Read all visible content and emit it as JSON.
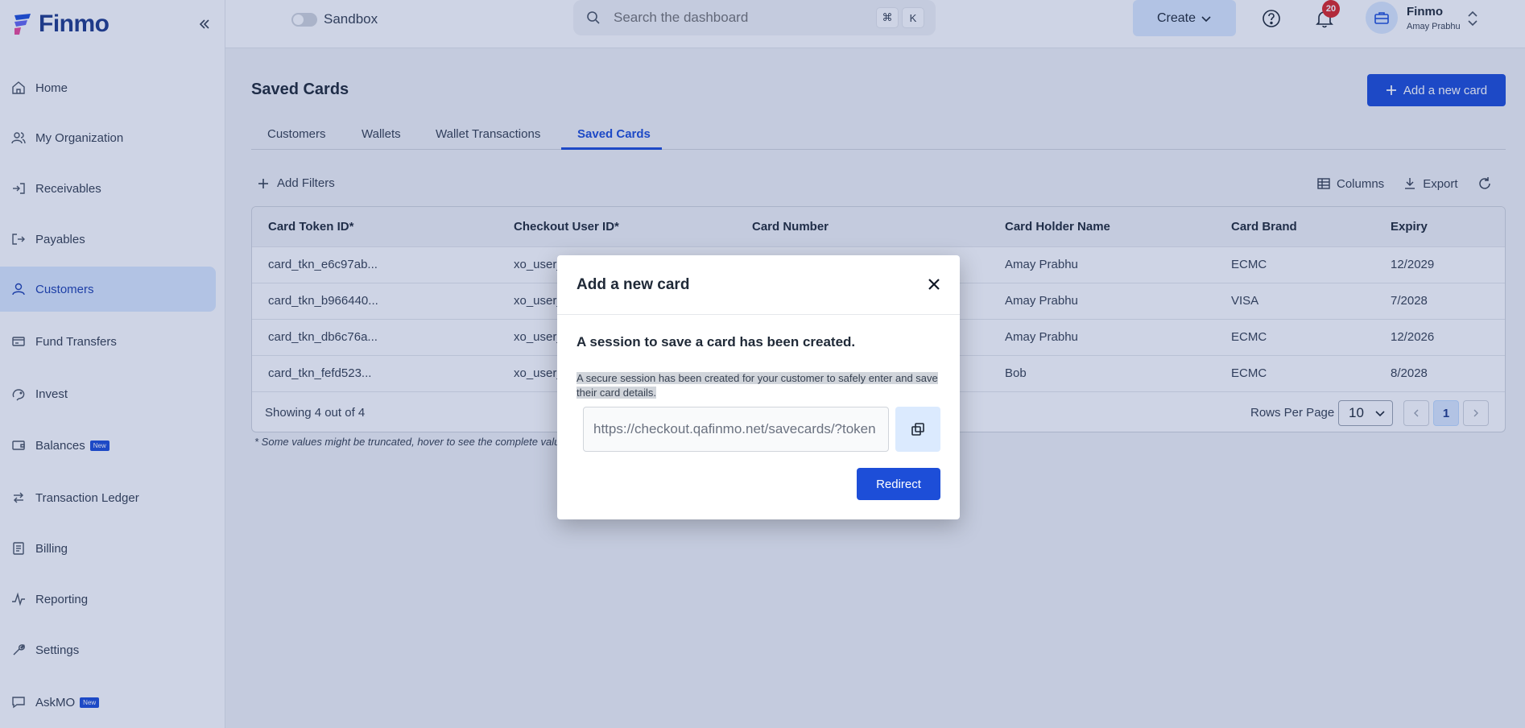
{
  "app": {
    "name": "Finmo"
  },
  "sidebar": {
    "items": [
      {
        "label": "Home",
        "icon": "home-icon"
      },
      {
        "label": "My Organization",
        "icon": "users-icon"
      },
      {
        "label": "Receivables",
        "icon": "receivables-icon"
      },
      {
        "label": "Payables",
        "icon": "payables-icon"
      },
      {
        "label": "Customers",
        "icon": "user-icon",
        "active": true
      },
      {
        "label": "Fund Transfers",
        "icon": "transfer-icon"
      },
      {
        "label": "Invest",
        "icon": "invest-icon"
      },
      {
        "label": "Balances",
        "icon": "wallet-icon",
        "badge": "New"
      },
      {
        "label": "Transaction Ledger",
        "icon": "ledger-icon"
      },
      {
        "label": "Billing",
        "icon": "billing-icon"
      },
      {
        "label": "Reporting",
        "icon": "reporting-icon"
      },
      {
        "label": "Settings",
        "icon": "settings-icon"
      },
      {
        "label": "AskMO",
        "icon": "chat-icon",
        "badge": "New"
      }
    ]
  },
  "topbar": {
    "sandbox_label": "Sandbox",
    "search_placeholder": "Search the dashboard",
    "shortcut_keys": [
      "⌘",
      "K"
    ],
    "create_label": "Create",
    "notification_count": "20",
    "org_name": "Finmo",
    "user_name": "Amay Prabhu"
  },
  "page": {
    "title": "Saved Cards",
    "add_button": "Add a new card",
    "tabs": [
      "Customers",
      "Wallets",
      "Wallet Transactions",
      "Saved Cards"
    ],
    "active_tab": "Saved Cards",
    "add_filters": "Add Filters",
    "columns_label": "Columns",
    "export_label": "Export"
  },
  "table": {
    "headers": [
      "Card Token ID*",
      "Checkout User ID*",
      "Card Number",
      "Card Holder Name",
      "Card Brand",
      "Expiry"
    ],
    "rows": [
      [
        "card_tkn_e6c97ab...",
        "xo_user_",
        "",
        "Amay Prabhu",
        "ECMC",
        "12/2029"
      ],
      [
        "card_tkn_b966440...",
        "xo_user_",
        "",
        "Amay Prabhu",
        "VISA",
        "7/2028"
      ],
      [
        "card_tkn_db6c76a...",
        "xo_user_",
        "",
        "Amay Prabhu",
        "ECMC",
        "12/2026"
      ],
      [
        "card_tkn_fefd523...",
        "xo_user_",
        "",
        "Bob",
        "ECMC",
        "8/2028"
      ]
    ],
    "showing": "Showing 4 out of 4",
    "rows_per_page_label": "Rows Per Page",
    "rows_per_page": "10",
    "current_page": "1"
  },
  "footnote": "* Some values might be truncated, hover to see the complete valu",
  "modal": {
    "title": "Add a new card",
    "heading": "A session to save a card has been created.",
    "description": "A secure session has been created for your customer to safely enter and save their card details.",
    "url": "https://checkout.qafinmo.net/savecards/?token",
    "redirect_label": "Redirect"
  },
  "colors": {
    "accent": "#1d4ed8",
    "active_bg": "#dbeafe",
    "badge": "#dc2626"
  }
}
